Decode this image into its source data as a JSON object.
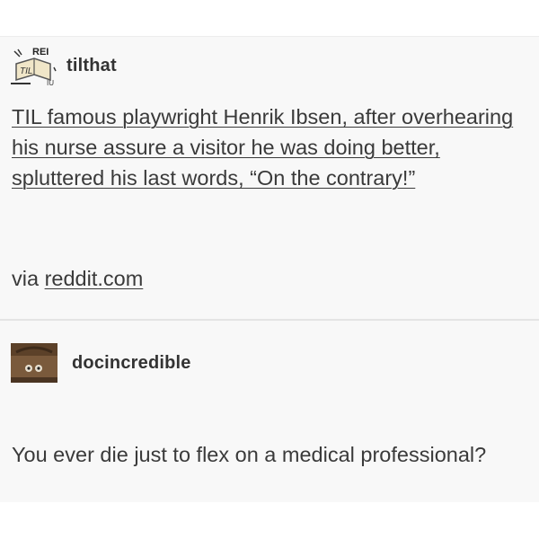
{
  "posts": [
    {
      "username": "tilthat",
      "avatar_icon": "til-logo-icon",
      "body": "TIL famous playwright Henrik Ibsen, after overhearing his nurse assure a visitor he was doing better, spluttered his last words, “On the contrary!”",
      "via_prefix": "via",
      "via_link": "reddit.com"
    },
    {
      "username": "docincredible",
      "avatar_icon": "user-avatar-icon",
      "body": "You ever die just to flex on a medical professional?"
    }
  ],
  "colors": {
    "background": "#f8f8f8",
    "text": "#3a3a3a",
    "divider": "#e4e4e4"
  }
}
